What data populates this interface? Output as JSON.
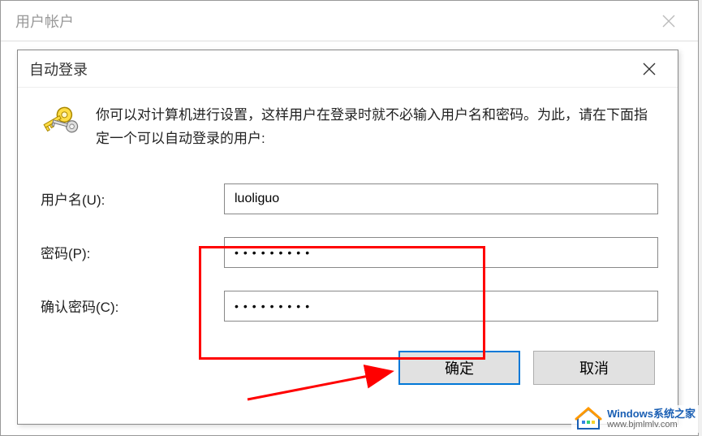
{
  "outer_window": {
    "title": "用户帐户"
  },
  "dialog": {
    "title": "自动登录",
    "info_text": "你可以对计算机进行设置，这样用户在登录时就不必输入用户名和密码。为此，请在下面指定一个可以自动登录的用户:"
  },
  "form": {
    "username_label": "用户名(U):",
    "username_value": "luoliguo",
    "password_label": "密码(P):",
    "password_value": "•••••••••",
    "confirm_label": "确认密码(C):",
    "confirm_value": "•••••••••"
  },
  "buttons": {
    "ok": "确定",
    "cancel": "取消"
  },
  "watermark": {
    "line1": "Windows系统之家",
    "line2": "www.bjmlmlv.com"
  }
}
